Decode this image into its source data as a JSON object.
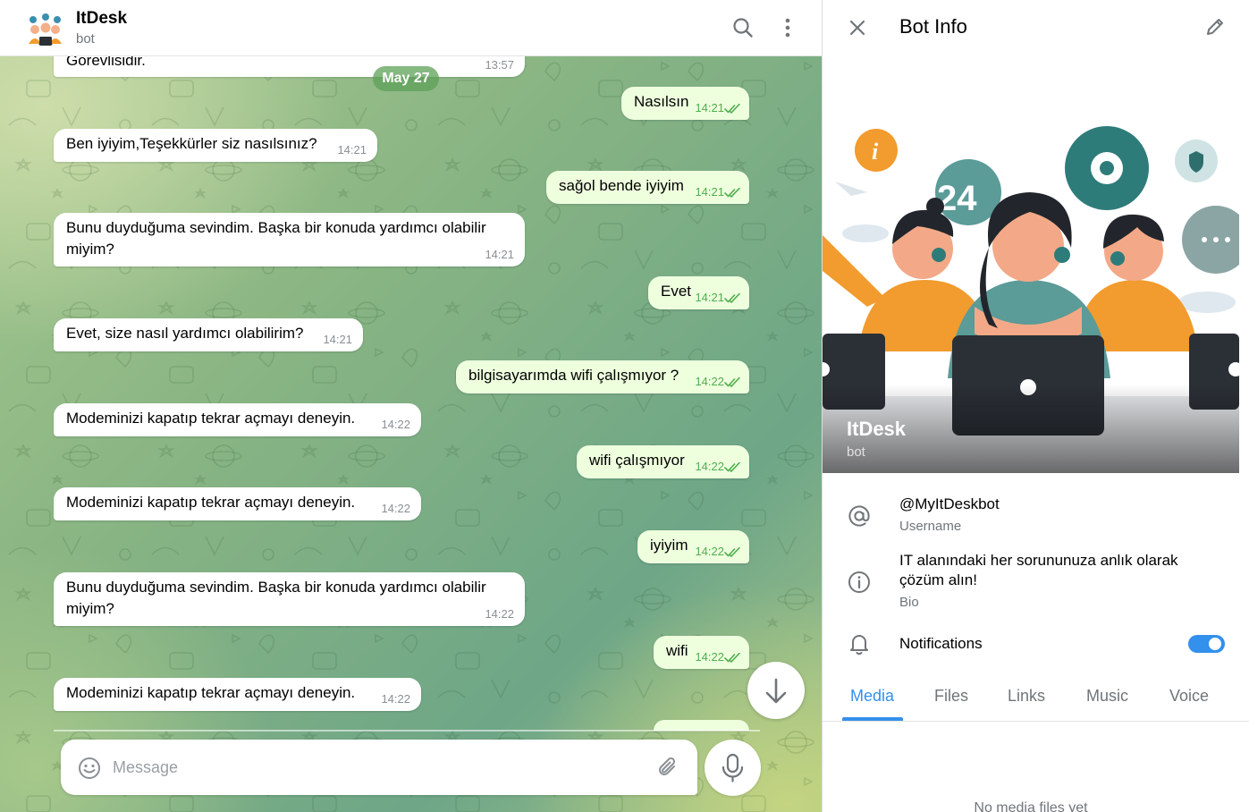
{
  "chat_header": {
    "title": "ItDesk",
    "subtitle": "bot"
  },
  "date_pill": "May 27",
  "partial_top_message": {
    "text": "Görevlisidir.",
    "time": "13:57"
  },
  "messages": [
    {
      "dir": "out",
      "text": "Nasılsın",
      "time": "14:21",
      "read": true
    },
    {
      "dir": "in",
      "text": "Ben iyiyim,Teşekkürler siz nasılsınız?",
      "time": "14:21"
    },
    {
      "dir": "out",
      "text": "sağol bende iyiyim",
      "time": "14:21",
      "read": true
    },
    {
      "dir": "in",
      "text": "Bunu duyduğuma sevindim. Başka bir konuda yardımcı olabilir miyim?",
      "time": "14:21"
    },
    {
      "dir": "out",
      "text": "Evet",
      "time": "14:21",
      "read": true
    },
    {
      "dir": "in",
      "text": "Evet, size nasıl yardımcı olabilirim?",
      "time": "14:21"
    },
    {
      "dir": "out",
      "text": "bilgisayarımda wifi çalışmıyor ?",
      "time": "14:22",
      "read": true
    },
    {
      "dir": "in",
      "text": "Modeminizi kapatıp tekrar açmayı deneyin.",
      "time": "14:22"
    },
    {
      "dir": "out",
      "text": "wifi çalışmıyor",
      "time": "14:22",
      "read": true
    },
    {
      "dir": "in",
      "text": "Modeminizi kapatıp tekrar açmayı deneyin.",
      "time": "14:22"
    },
    {
      "dir": "out",
      "text": "iyiyim",
      "time": "14:22",
      "read": true
    },
    {
      "dir": "in",
      "text": "Bunu duyduğuma sevindim. Başka bir konuda yardımcı olabilir miyim?",
      "time": "14:22"
    },
    {
      "dir": "out",
      "text": "wifi",
      "time": "14:22",
      "read": true
    },
    {
      "dir": "in",
      "text": "Modeminizi kapatıp tekrar açmayı deneyin.",
      "time": "14:22"
    }
  ],
  "composer": {
    "placeholder": "Message"
  },
  "info_panel": {
    "title": "Bot Info",
    "name": "ItDesk",
    "type": "bot",
    "hero_badge": "24",
    "username": "@MyItDeskbot",
    "username_label": "Username",
    "bio": "IT alanındaki her sorununuza anlık olarak çözüm alın!",
    "bio_label": "Bio",
    "notifications_label": "Notifications",
    "notifications_on": true,
    "tabs": [
      "Media",
      "Files",
      "Links",
      "Music",
      "Voice"
    ],
    "active_tab": "Media",
    "empty_text": "No media files yet"
  },
  "colors": {
    "accent": "#3390ec",
    "outgoing_bubble": "#eeffde",
    "read_ticks": "#4fae4e",
    "date_pill": "#5ea058"
  },
  "icons": {
    "header": [
      "search-icon",
      "more-vertical-icon"
    ],
    "info": [
      "close-icon",
      "edit-pencil-icon",
      "at-sign-icon",
      "info-icon",
      "bell-icon"
    ],
    "composer": [
      "emoji-icon",
      "attach-icon",
      "microphone-icon",
      "arrow-down-icon"
    ]
  }
}
